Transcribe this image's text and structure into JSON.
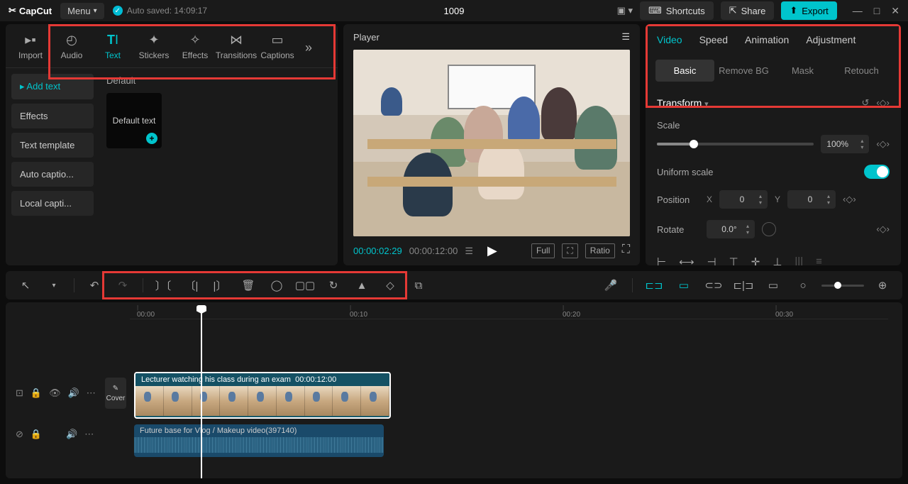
{
  "app_name": "CapCut",
  "menu_label": "Menu",
  "autosave_text": "Auto saved: 14:09:17",
  "project_title": "1009",
  "titlebar": {
    "shortcuts": "Shortcuts",
    "share": "Share",
    "export": "Export"
  },
  "media_tabs": {
    "import": "Import",
    "audio": "Audio",
    "text": "Text",
    "stickers": "Stickers",
    "effects": "Effects",
    "transitions": "Transitions",
    "captions": "Captions"
  },
  "sidebar": {
    "items": [
      {
        "label": "Add text"
      },
      {
        "label": "Effects"
      },
      {
        "label": "Text template"
      },
      {
        "label": "Auto captio..."
      },
      {
        "label": "Local capti..."
      }
    ]
  },
  "content": {
    "header": "Default",
    "card_label": "Default text"
  },
  "player": {
    "title": "Player",
    "current_time": "00:00:02:29",
    "duration": "00:00:12:00",
    "full": "Full",
    "ratio": "Ratio"
  },
  "right_panel": {
    "tabs": [
      "Video",
      "Speed",
      "Animation",
      "Adjustment"
    ],
    "subtabs": [
      "Basic",
      "Remove BG",
      "Mask",
      "Retouch"
    ],
    "transform_title": "Transform",
    "scale_label": "Scale",
    "scale_value": "100%",
    "uniform_label": "Uniform scale",
    "position_label": "Position",
    "pos_x_label": "X",
    "pos_x_value": "0",
    "pos_y_label": "Y",
    "pos_y_value": "0",
    "rotate_label": "Rotate",
    "rotate_value": "0.0°"
  },
  "timeline": {
    "ruler": [
      "00:00",
      "00:10",
      "00:20",
      "00:30"
    ],
    "cover_label": "Cover",
    "video_clip": {
      "title": "Lecturer watching his class during an exam",
      "duration": "00:00:12:00"
    },
    "audio_clip": {
      "title": "Future base for Vlog / Makeup video(397140)"
    }
  }
}
